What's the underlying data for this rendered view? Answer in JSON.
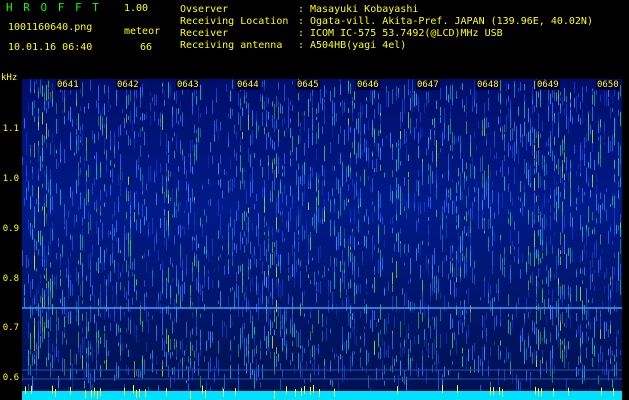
{
  "header": {
    "app_title": "H R O F F T",
    "app_version": "1.00",
    "file_name": "1001160640.png",
    "meteor_label": "meteor",
    "datetime": "10.01.16 06:40",
    "meteor_count": "66"
  },
  "info": [
    {
      "label": "Ovserver",
      "sep": ":",
      "value": "Masayuki Kobayashi"
    },
    {
      "label": "Receiving Location",
      "sep": ":",
      "value": "Ogata-vill. Akita-Pref. JAPAN (139.96E, 40.02N)"
    },
    {
      "label": "Receiver",
      "sep": ":",
      "value": "ICOM IC-575 53.7492(@LCD)MHz USB"
    },
    {
      "label": "Receiving antenna",
      "sep": ":",
      "value": "A504HB(yagi 4el)"
    }
  ],
  "y_axis": {
    "unit": "kHz",
    "ticks": [
      "1.1",
      "1.0",
      "0.9",
      "0.8",
      "0.7",
      "0.6"
    ]
  },
  "x_axis": {
    "ticks": [
      "0641",
      "0642",
      "0643",
      "0644",
      "0645",
      "0646",
      "0647",
      "0648",
      "0649",
      "0650"
    ]
  },
  "colors": {
    "text": "#ffff00",
    "title": "#00ff00",
    "background": "#000000",
    "signal_line": "#3fa0ff",
    "noise_floor": "#00e0ff"
  }
}
